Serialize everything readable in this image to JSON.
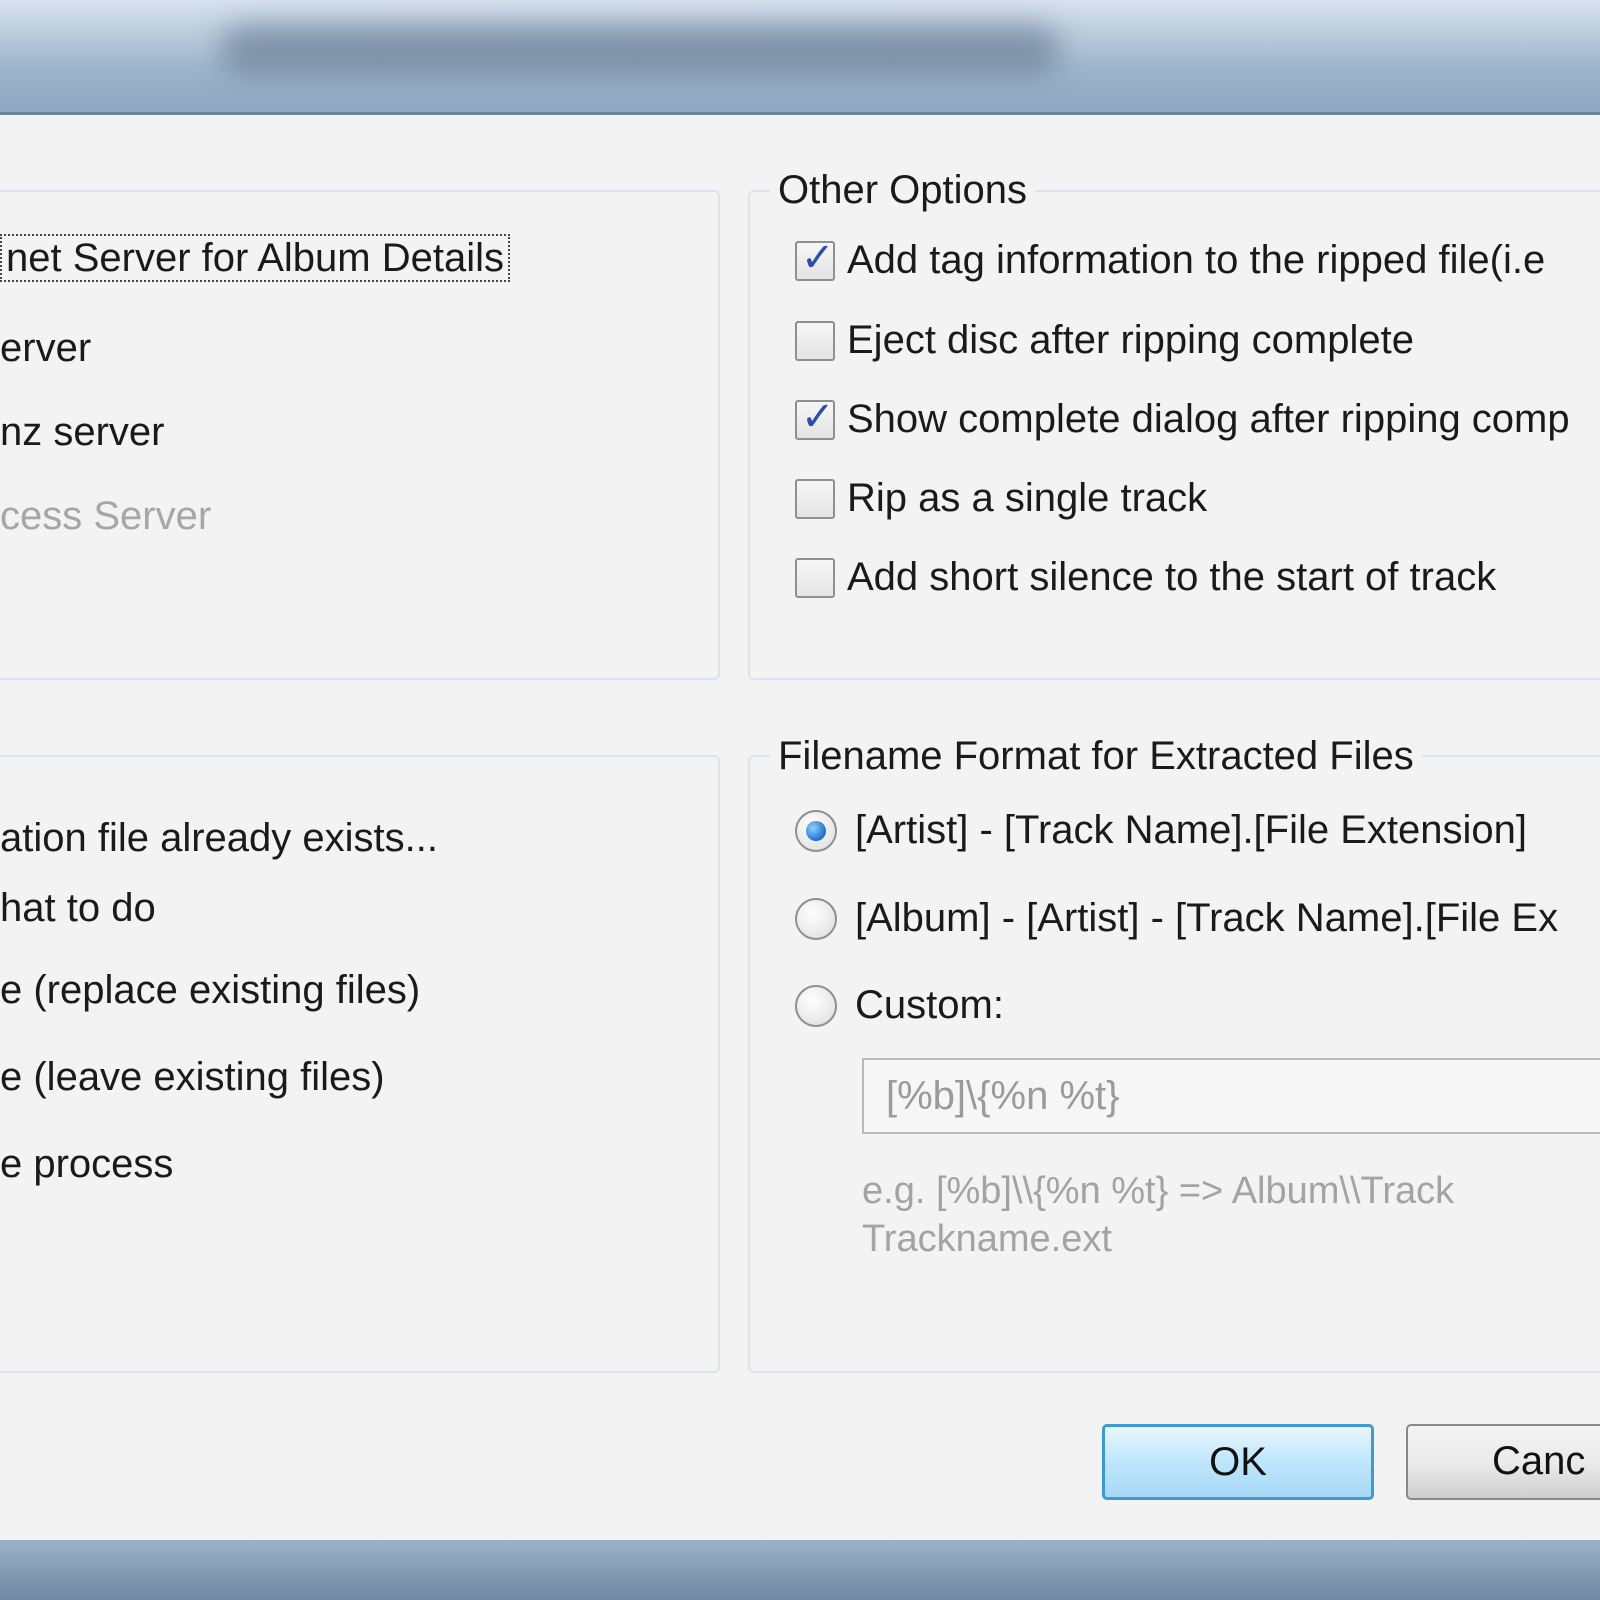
{
  "lookup_group": {
    "items": [
      {
        "label": "net Server for Album Details"
      },
      {
        "label": "erver"
      },
      {
        "label": "nz server"
      },
      {
        "label": "cess Server"
      }
    ]
  },
  "exists_group": {
    "heading": "ation file already exists...",
    "items": [
      {
        "label": "hat to do"
      },
      {
        "label": "e (replace existing files)"
      },
      {
        "label": "e (leave existing files)"
      },
      {
        "label": "e process"
      }
    ]
  },
  "other_options": {
    "legend": "Other Options",
    "items": [
      {
        "label": "Add tag information to the ripped file(i.e",
        "checked": true
      },
      {
        "label": "Eject disc after ripping complete",
        "checked": false
      },
      {
        "label": "Show complete dialog after ripping comp",
        "checked": true
      },
      {
        "label": "Rip as a single track",
        "checked": false
      },
      {
        "label": "Add short silence to the start of track",
        "checked": false
      }
    ]
  },
  "filename_format": {
    "legend": "Filename Format for Extracted Files",
    "options": [
      {
        "label": "[Artist] - [Track Name].[File Extension]",
        "selected": true
      },
      {
        "label": "[Album] - [Artist] - [Track Name].[File Ex",
        "selected": false
      },
      {
        "label": "Custom:",
        "selected": false
      }
    ],
    "custom_value": "[%b]\\{%n %t}",
    "example_line1": "e.g. [%b]\\\\{%n %t}  => Album\\\\Track",
    "example_line2": "Trackname.ext"
  },
  "buttons": {
    "ok": "OK",
    "cancel": "Canc"
  }
}
